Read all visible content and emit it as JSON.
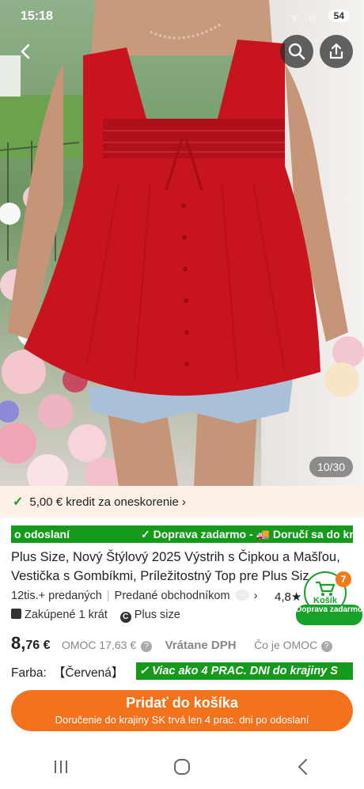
{
  "status": {
    "time": "15:18",
    "battery": "54",
    "signal": "ᯤ .ıl"
  },
  "gallery": {
    "counter": "10/30"
  },
  "credit": {
    "check": "✓",
    "text": "5,00 € kredit za oneskorenie",
    "chevron": "›"
  },
  "ticker": {
    "left": "o odoslaní",
    "right": "✓ Doprava zadarmo - 🚚 Doručí sa do kra"
  },
  "product": {
    "title": "Plus Size, Nový Štýlový 2025 Výstrih s Čipkou a Mašľou, Vestička s Gombíkmi, Príležitostný Top pre Plus Siz",
    "sold": "12tis.+ predaných",
    "seller": "Predané obchodníkom",
    "seller_chevron": "›",
    "rating": "4,8★",
    "badge1": "Zakúpené 1 krát",
    "badge2_icon": "C",
    "badge2": "Plus size",
    "price_whole": "8,",
    "price_dec": "76 €",
    "omoc": "OMOC 17,63 €",
    "vat": "Vrátane DPH",
    "what": "Čo je OMOC",
    "q1": "?",
    "q2": "?",
    "color_label": "Farba:",
    "color_value": "【Červená】",
    "delivery_tag": "✓ Viac ako 4 PRAC. DNI do krajiny S"
  },
  "cart": {
    "count": "7",
    "label": "Košík",
    "free": "Doprava zadarmo"
  },
  "add_button": {
    "label": "Pridať do košíka",
    "sub": "Doručenie do krajiny SK trvá len 4 prac. dni po odoslaní"
  },
  "colors": {
    "accent": "#f2721d",
    "green": "#159a1b",
    "shirt": "#c8141f"
  }
}
